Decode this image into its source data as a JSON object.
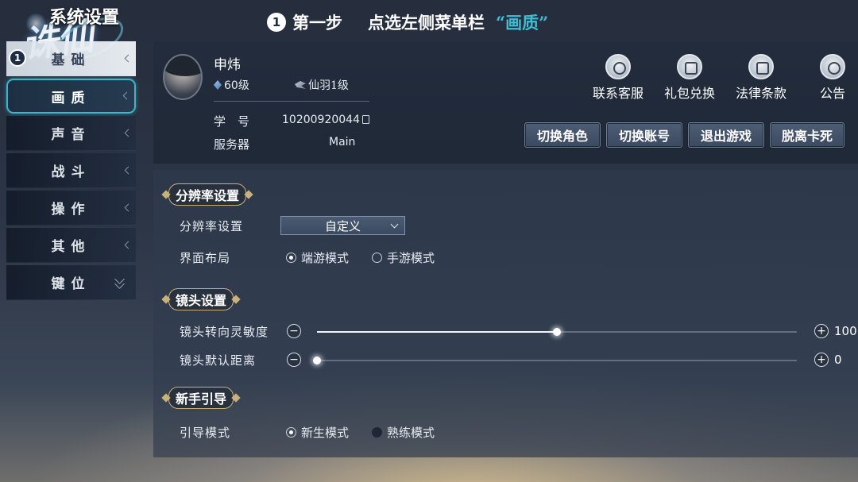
{
  "header": {
    "title": "系统设置",
    "step_number": "1",
    "step_label": "第一步",
    "step_instruction": "点选左侧菜单栏",
    "step_target": "“画质”"
  },
  "menu": {
    "marker": "1",
    "items": [
      {
        "label": "基础"
      },
      {
        "label": "画质"
      },
      {
        "label": "声音"
      },
      {
        "label": "战斗"
      },
      {
        "label": "操作"
      },
      {
        "label": "其他"
      },
      {
        "label": "键位"
      }
    ]
  },
  "profile": {
    "name": "申炜",
    "level": "60级",
    "rank": "仙羽1级",
    "id_label": "学　号",
    "id_value": "10200920044",
    "server_label": "服务器",
    "server_value": "Main",
    "services": [
      {
        "label": "联系客服",
        "icon": "headset-icon"
      },
      {
        "label": "礼包兑换",
        "icon": "gift-icon"
      },
      {
        "label": "法律条款",
        "icon": "scroll-icon"
      },
      {
        "label": "公告",
        "icon": "announcement-icon"
      }
    ],
    "buttons": {
      "switch_role": "切换角色",
      "switch_account": "切换账号",
      "exit_game": "退出游戏",
      "unstuck": "脱离卡死"
    }
  },
  "settings": {
    "resolution_section": "分辨率设置",
    "resolution_label": "分辨率设置",
    "resolution_value": "自定义",
    "layout_label": "界面布局",
    "layout_options": {
      "pc": "端游模式",
      "mobile": "手游模式"
    },
    "layout_selected": "端游模式",
    "camera_section": "镜头设置",
    "camera_sensitivity_label": "镜头转向灵敏度",
    "camera_sensitivity_value": "100",
    "camera_sensitivity_fraction": 0.5,
    "camera_distance_label": "镜头默认距离",
    "camera_distance_value": "0",
    "camera_distance_fraction": 0.0,
    "guide_section": "新手引导",
    "guide_label": "引导模式",
    "guide_options": {
      "novice": "新生模式",
      "expert": "熟练模式"
    },
    "guide_selected": "新生模式"
  },
  "colors": {
    "accent": "#38c1d6",
    "section_gold": "#c8b27c"
  }
}
